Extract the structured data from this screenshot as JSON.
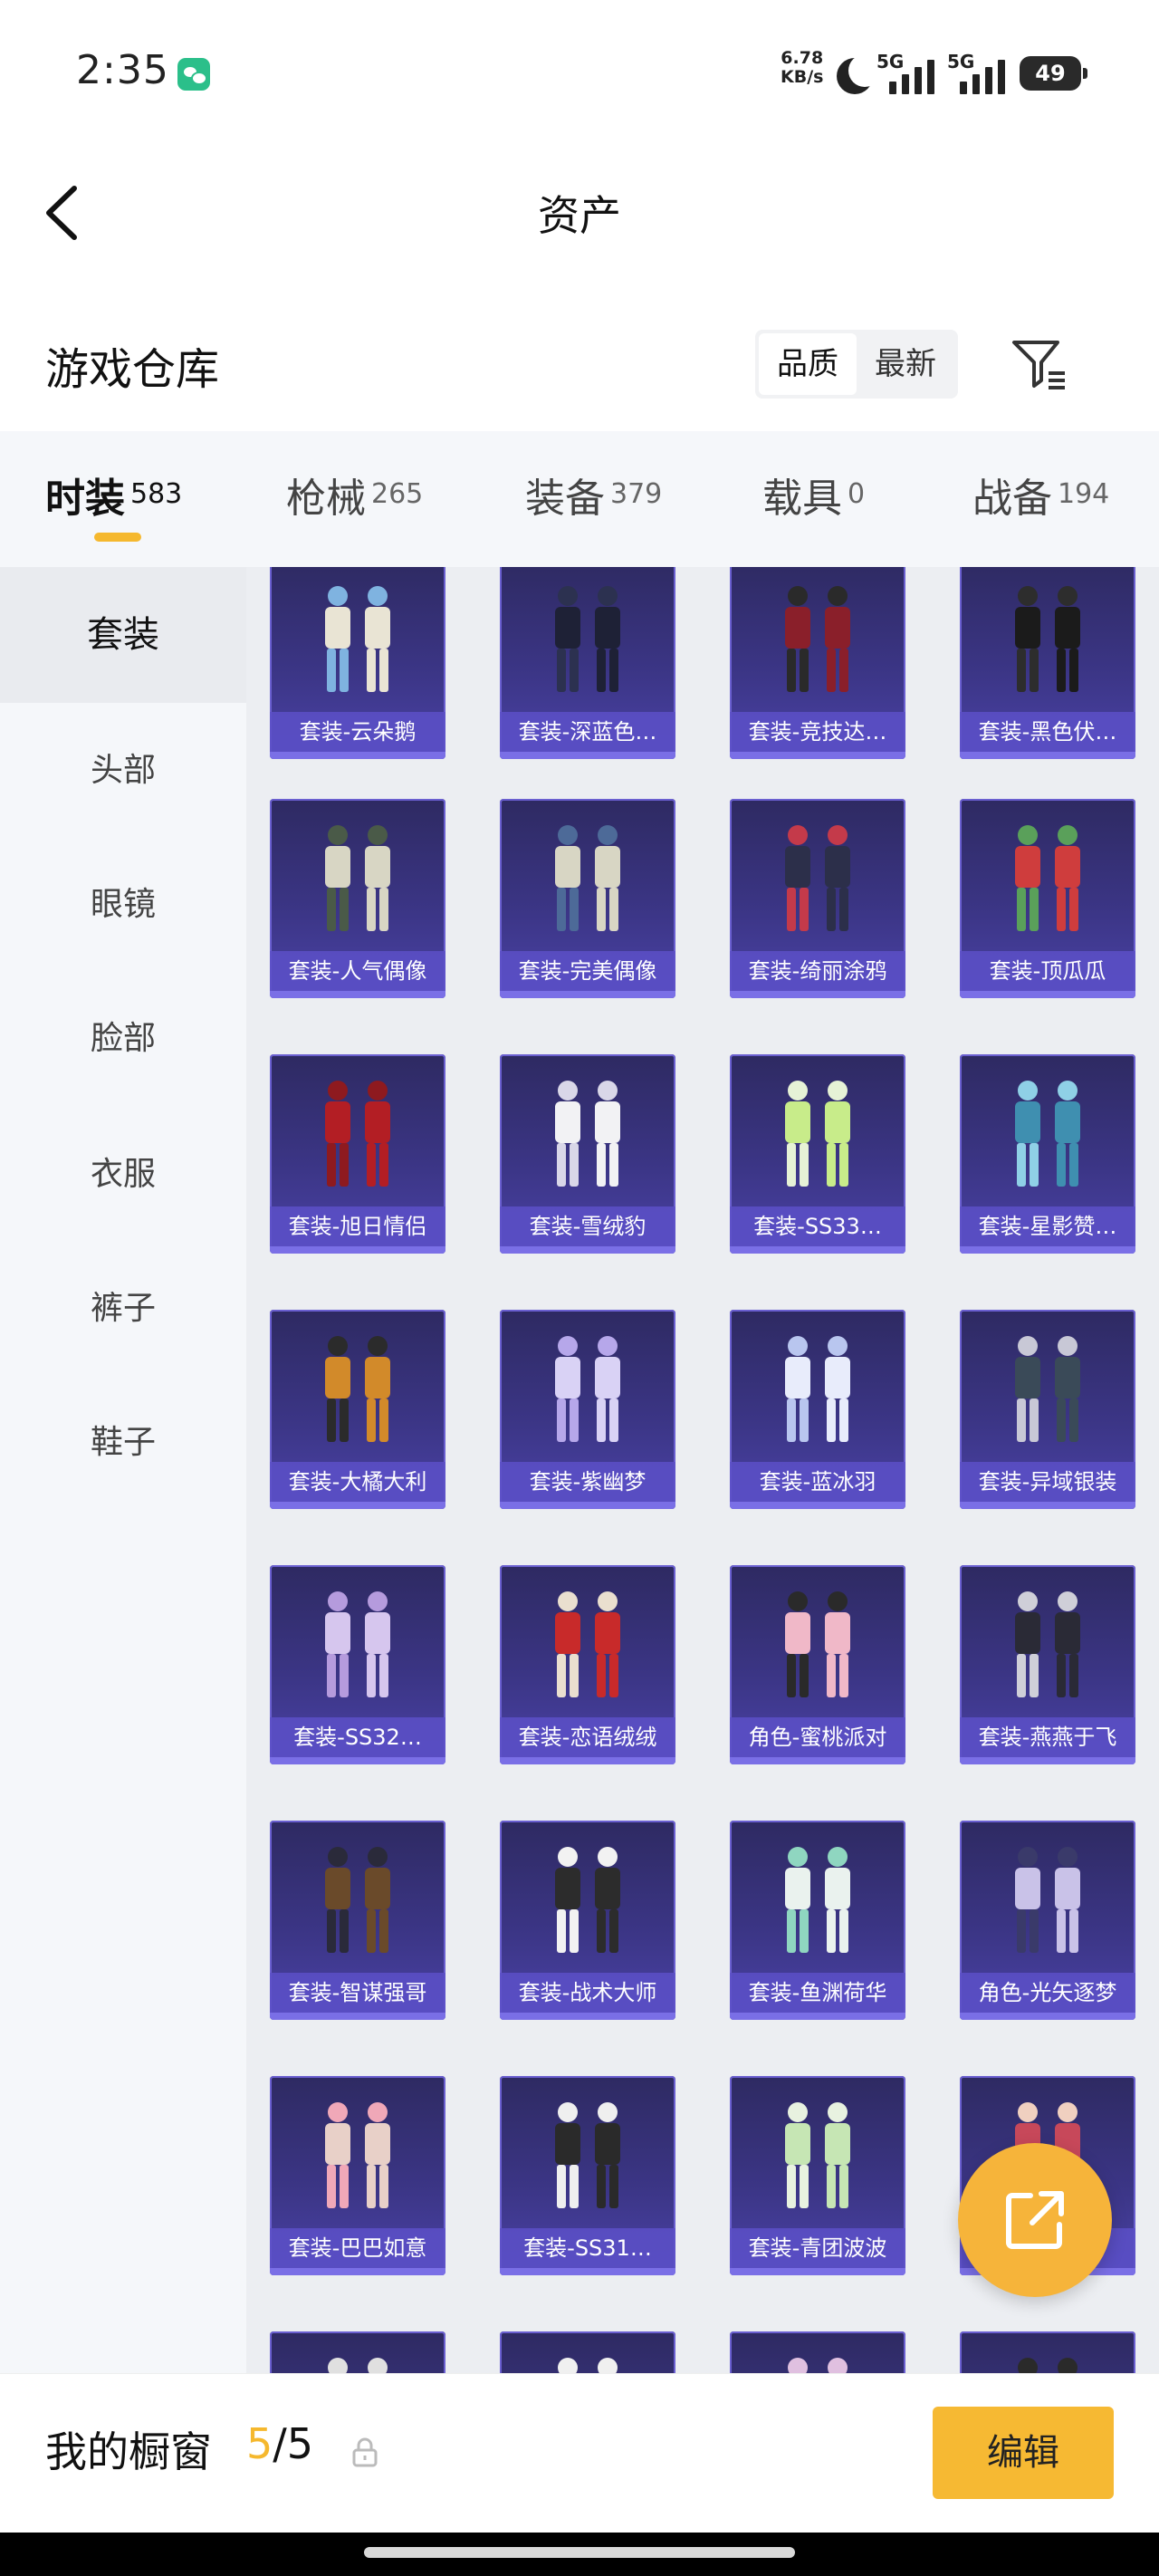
{
  "status_bar": {
    "time": "2:35",
    "net_speed_value": "6.78",
    "net_speed_unit": "KB/s",
    "sim1_label": "5G",
    "sim2_label": "5G",
    "battery": "49"
  },
  "header": {
    "title": "资产"
  },
  "warehouse": {
    "title": "游戏仓库",
    "sort_options": [
      "品质",
      "最新"
    ],
    "sort_selected": "品质"
  },
  "tabs": [
    {
      "label": "时装",
      "count": "583",
      "active": true
    },
    {
      "label": "枪械",
      "count": "265"
    },
    {
      "label": "装备",
      "count": "379"
    },
    {
      "label": "载具",
      "count": "0"
    },
    {
      "label": "战备",
      "count": "194"
    }
  ],
  "sidebar": {
    "items": [
      {
        "label": "套装",
        "active": true
      },
      {
        "label": "头部"
      },
      {
        "label": "眼镜"
      },
      {
        "label": "脸部"
      },
      {
        "label": "衣服"
      },
      {
        "label": "裤子"
      },
      {
        "label": "鞋子"
      }
    ]
  },
  "items": [
    {
      "label": "套装-云朵鹅",
      "palette": [
        "#e9e4d4",
        "#7fb3e0"
      ]
    },
    {
      "label": "套装-深蓝色…",
      "palette": [
        "#1e2136",
        "#2c3150"
      ]
    },
    {
      "label": "套装-竞技达…",
      "palette": [
        "#8a1f2a",
        "#2a2a2a"
      ]
    },
    {
      "label": "套装-黑色伏…",
      "palette": [
        "#1b1b1b",
        "#2d2d2d"
      ]
    },
    {
      "label": "套装-人气偶像",
      "palette": [
        "#d8d6c4",
        "#4a5a48"
      ]
    },
    {
      "label": "套装-完美偶像",
      "palette": [
        "#d8d6c4",
        "#4d6a98"
      ]
    },
    {
      "label": "套装-绮丽涂鸦",
      "palette": [
        "#2c2f4a",
        "#c43a4a"
      ]
    },
    {
      "label": "套装-顶瓜瓜",
      "palette": [
        "#cf3d3d",
        "#5aa05a"
      ]
    },
    {
      "label": "套装-旭日情侣",
      "palette": [
        "#b31e24",
        "#8e1a1f"
      ]
    },
    {
      "label": "套装-雪绒豹",
      "palette": [
        "#f2f2f4",
        "#d9d7e8"
      ]
    },
    {
      "label": "套装-SS33…",
      "palette": [
        "#c8ec8a",
        "#e6f2d6"
      ]
    },
    {
      "label": "套装-星影赞…",
      "palette": [
        "#3f8fb0",
        "#8fd0e6"
      ]
    },
    {
      "label": "套装-大橘大利",
      "palette": [
        "#d28a2a",
        "#2b2b2b"
      ]
    },
    {
      "label": "套装-紫幽梦",
      "palette": [
        "#d9d2f5",
        "#b6a7ea"
      ]
    },
    {
      "label": "套装-蓝冰羽",
      "palette": [
        "#e8ecfb",
        "#b9c6ef"
      ]
    },
    {
      "label": "套装-异域银装",
      "palette": [
        "#3a4a58",
        "#c8c8d6"
      ]
    },
    {
      "label": "套装-SS32…",
      "palette": [
        "#d6c6ee",
        "#b59bdd"
      ]
    },
    {
      "label": "套装-恋语绒绒",
      "palette": [
        "#c82a2a",
        "#eadfcf"
      ]
    },
    {
      "label": "角色-蜜桃派对",
      "palette": [
        "#f0b8c8",
        "#2a2a2a"
      ]
    },
    {
      "label": "套装-燕燕于飞",
      "palette": [
        "#2a2a36",
        "#cfcfd8"
      ]
    },
    {
      "label": "套装-智谋强哥",
      "palette": [
        "#6a4a2a",
        "#2a2a3a"
      ]
    },
    {
      "label": "套装-战术大师",
      "palette": [
        "#2c2c2c",
        "#f2f2f2"
      ]
    },
    {
      "label": "套装-鱼渊荷华",
      "palette": [
        "#eaf2ee",
        "#8fd6c0"
      ]
    },
    {
      "label": "角色-光矢逐梦",
      "palette": [
        "#c9c2e8",
        "#3a3a6a"
      ]
    },
    {
      "label": "套装-巴巴如意",
      "palette": [
        "#e8d0c8",
        "#f0a8b8"
      ]
    },
    {
      "label": "套装-SS31…",
      "palette": [
        "#2a2a2a",
        "#efefef"
      ]
    },
    {
      "label": "套装-青团波波",
      "palette": [
        "#c6e6b4",
        "#e8f2e0"
      ]
    },
    {
      "label": "",
      "palette": [
        "#c7485a",
        "#f0d0c0"
      ]
    },
    {
      "label": "",
      "palette": [
        "#2a3a2a",
        "#e0e0e0"
      ]
    },
    {
      "label": "",
      "palette": [
        "#5a8ad0",
        "#f0f0f0"
      ]
    },
    {
      "label": "",
      "palette": [
        "#c890c8",
        "#e0c0e0"
      ]
    },
    {
      "label": "",
      "palette": [
        "#e8e0d0",
        "#2a2a2a"
      ]
    }
  ],
  "showcase": {
    "label": "我的橱窗",
    "current": "5",
    "separator": "/",
    "total": "5",
    "edit_label": "编辑"
  },
  "colors": {
    "accent": "#f5b82e",
    "card_bg": "#3b3585",
    "card_label_bg": "#5c50c8"
  },
  "icons": {
    "back": "chevron-left-icon",
    "filter": "filter-icon",
    "share": "external-link-icon",
    "lock": "lock-icon"
  }
}
